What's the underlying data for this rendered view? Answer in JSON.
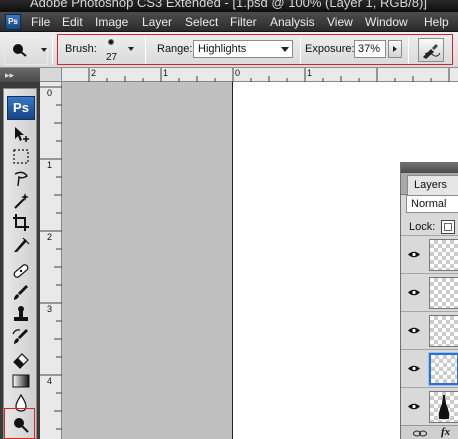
{
  "window": {
    "title": "Adobe Photoshop CS3 Extended - [1.psd @ 100% (Layer 1, RGB/8)]"
  },
  "app_badge": "Ps",
  "menu": [
    "File",
    "Edit",
    "Image",
    "Layer",
    "Select",
    "Filter",
    "Analysis",
    "View",
    "Window",
    "Help"
  ],
  "options": {
    "brush_label": "Brush:",
    "brush_size": "27",
    "range_label": "Range:",
    "range_value": "Highlights",
    "exposure_label": "Exposure:",
    "exposure_value": "37%"
  },
  "rulers": {
    "top": [
      "2",
      "1",
      "0",
      "1"
    ],
    "left": [
      "0",
      "1",
      "2",
      "3",
      "4"
    ]
  },
  "tools": [
    "move-tool",
    "marquee-tool",
    "lasso-tool",
    "magic-wand-tool",
    "crop-tool",
    "slice-tool",
    "healing-brush-tool",
    "brush-tool",
    "clone-stamp-tool",
    "history-brush-tool",
    "eraser-tool",
    "gradient-tool",
    "blur-tool",
    "dodge-tool"
  ],
  "layers_panel": {
    "tab": "Layers",
    "blend_mode": "Normal",
    "lock_label": "Lock:",
    "footer_fx": "fx"
  },
  "colors": {
    "highlight_red": "#dd2222",
    "ps_blue": "#1d5aa8"
  }
}
